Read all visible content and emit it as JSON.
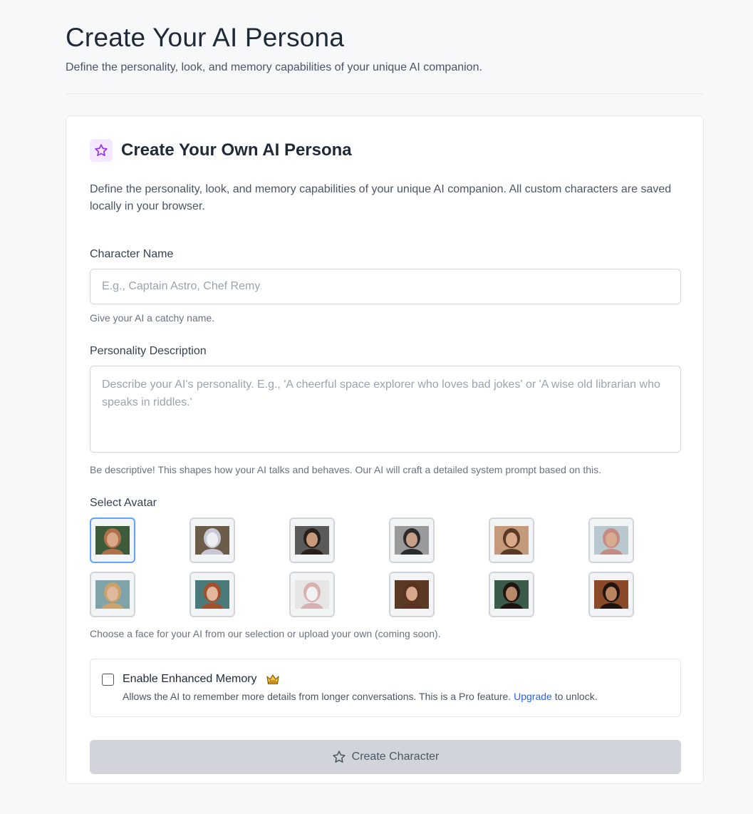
{
  "page": {
    "title": "Create Your AI Persona",
    "subtitle": "Define the personality, look, and memory capabilities of your unique AI companion."
  },
  "card": {
    "icon": "star-icon",
    "title": "Create Your Own AI Persona",
    "description": "Define the personality, look, and memory capabilities of your unique AI companion. All custom characters are saved locally in your browser."
  },
  "name_field": {
    "label": "Character Name",
    "placeholder": "E.g., Captain Astro, Chef Remy",
    "value": "",
    "hint": "Give your AI a catchy name."
  },
  "personality_field": {
    "label": "Personality Description",
    "placeholder": "Describe your AI's personality. E.g., 'A cheerful space explorer who loves bad jokes' or 'A wise old librarian who speaks in riddles.'",
    "value": "",
    "hint": "Be descriptive! This shapes how your AI talks and behaves. Our AI will craft a detailed system prompt based on this."
  },
  "avatar_section": {
    "label": "Select Avatar",
    "selected_index": 0,
    "hint": "Choose a face for your AI from our selection or upload your own (coming soon).",
    "avatars": [
      {
        "name": "fantasy-elf-avatar",
        "bg": "#3d5a3a",
        "skin": "#d9a98a",
        "hair": "#b0704a"
      },
      {
        "name": "white-kitten-avatar",
        "bg": "#6b5d4a",
        "skin": "#eeeef2",
        "hair": "#c9c9d6"
      },
      {
        "name": "dark-haired-woman-avatar",
        "bg": "#5a5a5a",
        "skin": "#c79a7c",
        "hair": "#2a1f1a"
      },
      {
        "name": "bald-man-avatar",
        "bg": "#9a9a9a",
        "skin": "#c9a087",
        "hair": "#2b2b2b"
      },
      {
        "name": "brunette-woman-avatar",
        "bg": "#c49a7a",
        "skin": "#d9aa88",
        "hair": "#5a3a25"
      },
      {
        "name": "hijab-woman-avatar",
        "bg": "#b9c7cf",
        "skin": "#d6ad8f",
        "hair": "#c48b84"
      },
      {
        "name": "blond-man-avatar",
        "bg": "#7fa3a8",
        "skin": "#e0b89e",
        "hair": "#c9a36a"
      },
      {
        "name": "redhead-woman-avatar",
        "bg": "#4a7a7a",
        "skin": "#e3b79c",
        "hair": "#a4502e"
      },
      {
        "name": "white-bunny-avatar",
        "bg": "#e6e6e6",
        "skin": "#f2f2f2",
        "hair": "#d9b0b0"
      },
      {
        "name": "library-woman-avatar",
        "bg": "#5a3a25",
        "skin": "#d6a98a",
        "hair": "#5a3220"
      },
      {
        "name": "indian-woman-avatar",
        "bg": "#3a5a4a",
        "skin": "#b98a6a",
        "hair": "#1f1410"
      },
      {
        "name": "indian-man-avatar",
        "bg": "#8a4a2a",
        "skin": "#b9845e",
        "hair": "#1f1410"
      }
    ]
  },
  "memory": {
    "label": "Enable Enhanced Memory",
    "icon": "crown-icon",
    "checked": false,
    "description_prefix": "Allows the AI to remember more details from longer conversations. This is a Pro feature.",
    "link_text": "Upgrade",
    "description_suffix": "to unlock."
  },
  "submit": {
    "label": "Create Character",
    "icon": "star-icon",
    "disabled": true
  },
  "colors": {
    "background": "#f6f8fa",
    "accent": "#9333ea",
    "link": "#2563eb",
    "selected_border": "#60a5fa"
  }
}
